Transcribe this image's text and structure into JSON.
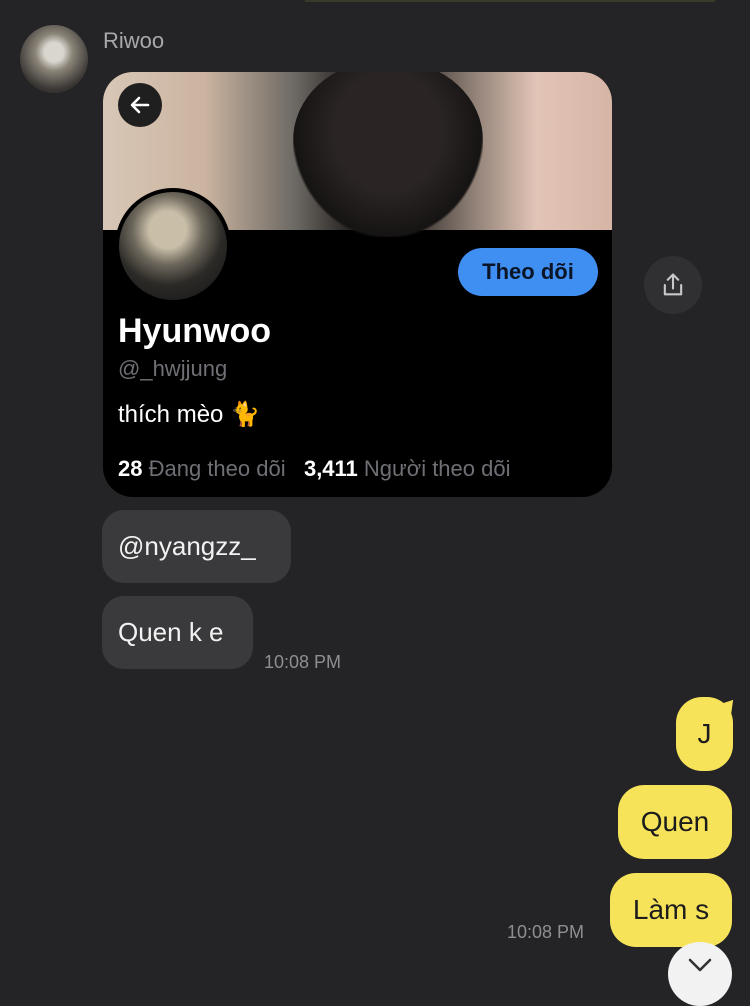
{
  "chat": {
    "sender_name": "Riwoo",
    "profile_card": {
      "name": "Hyunwoo",
      "handle": "@_hwjjung",
      "bio": "thích mèo 🐈",
      "follow_label": "Theo dõi",
      "following_count": "28",
      "following_label": "Đang theo dõi",
      "followers_count": "3,411",
      "followers_label": "Người theo dõi"
    },
    "incoming": [
      {
        "text": "@nyangzz_"
      },
      {
        "text": "Quen k e"
      }
    ],
    "incoming_time": "10:08 PM",
    "outgoing": [
      {
        "text": "J"
      },
      {
        "text": "Quen"
      },
      {
        "text": "Làm s"
      }
    ],
    "outgoing_time": "10:08 PM"
  },
  "icons": {
    "back": "arrow-left-icon",
    "share": "share-icon",
    "scroll": "chevron-down-icon"
  },
  "colors": {
    "background": "#242426",
    "incoming_bubble": "#3a3a3c",
    "outgoing_bubble": "#f7e35a",
    "follow_button": "#3f8ef2"
  }
}
